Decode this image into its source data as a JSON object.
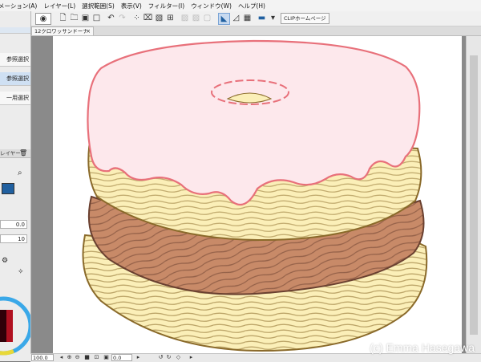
{
  "menu": {
    "items": [
      "メーション(A)",
      "レイヤー(L)",
      "選択範囲(S)",
      "表示(V)",
      "フィルター(I)",
      "ウィンドウ(W)",
      "ヘルプ(H)"
    ]
  },
  "toolbar": {
    "clip_button_label": "CLIPホームページ"
  },
  "document": {
    "tab_label": "12クロワッサンドーナツ.psd",
    "close_glyph": "×"
  },
  "left_panel": {
    "items": [
      "参照選択",
      "参照選択",
      "一用選択"
    ],
    "layer_header": "レイヤー",
    "field_values": [
      "0.0",
      "10"
    ]
  },
  "bottom_bar": {
    "zoom_value": "100.0",
    "angle_value": "0.0"
  },
  "artwork": {
    "subject": "croissant doughnut with pink icing",
    "colors": {
      "icing": "#fde8ec",
      "icing_outline": "#e8707a",
      "pastry": "#fbefb8",
      "pastry_lines": "#8a6a2a",
      "cream": "#c88a68",
      "cream_lines": "#6a4030"
    }
  },
  "watermark": "(c) Emma Hasegawa"
}
